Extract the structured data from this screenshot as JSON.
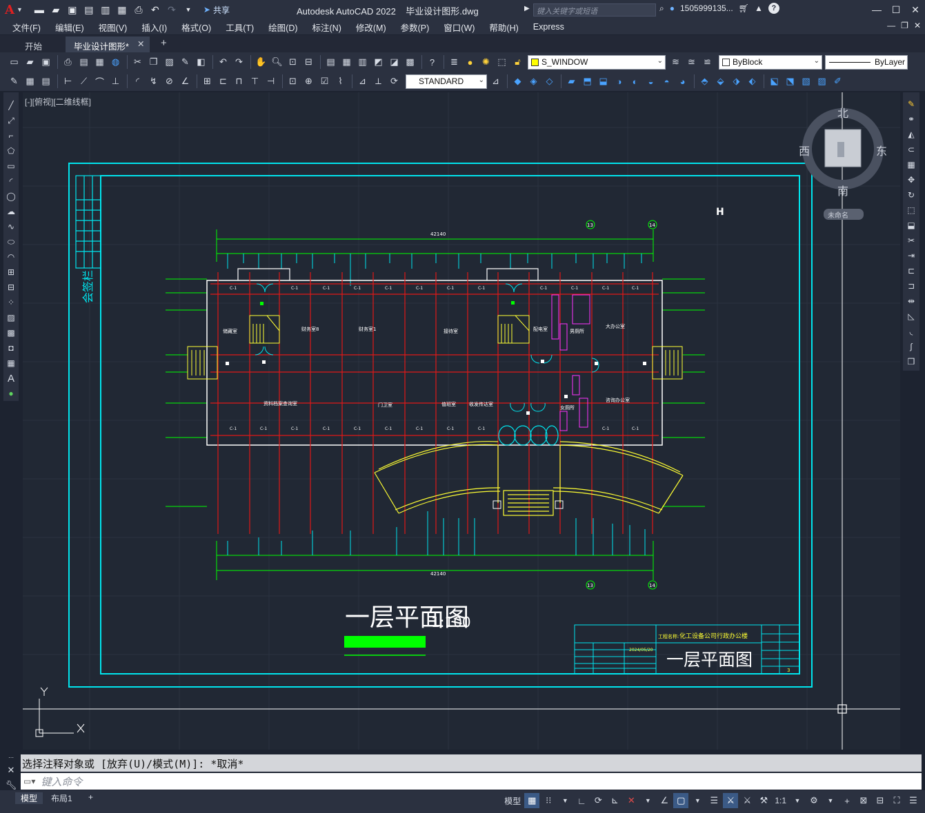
{
  "app": {
    "logo": "A",
    "title": "Autodesk AutoCAD 2022    毕业设计图形.dwg",
    "share_label": "共享",
    "search_placeholder": "键入关键字或短语",
    "user": "1505999135...",
    "window_controls": [
      "minimize-icon",
      "restore-icon",
      "close-icon"
    ]
  },
  "menu": [
    "文件(F)",
    "编辑(E)",
    "视图(V)",
    "插入(I)",
    "格式(O)",
    "工具(T)",
    "绘图(D)",
    "标注(N)",
    "修改(M)",
    "参数(P)",
    "窗口(W)",
    "帮助(H)",
    "Express"
  ],
  "tabs": {
    "start": "开始",
    "active": "毕业设计图形*",
    "add": "+"
  },
  "toolbar": {
    "layer_name": "S_WINDOW",
    "layer_color": "#ffff00",
    "color_combo": "ByBlock",
    "linetype_combo": "ByLayer",
    "textstyle_combo": "STANDARD"
  },
  "viewport": {
    "label": "[-][俯视][二维线框]",
    "viewcube": {
      "north": "北",
      "south": "南",
      "east": "东",
      "west": "西",
      "wcs": "未命名"
    }
  },
  "drawing": {
    "signature_strip": "会签栏",
    "plan_title": "一层平面图",
    "scale": "1:100",
    "overall_dim": "42140",
    "axis_left": "13",
    "axis_right": "14",
    "rooms": [
      "储藏室",
      "财务室8",
      "财务室1",
      "接待室",
      "配电室",
      "男厕所",
      "大办公室",
      "资料档案查询室",
      "门卫室",
      "值班室",
      "收发传达室",
      "女厕所",
      "咨询办公室"
    ],
    "title_block": {
      "project_label": "工程名称:",
      "project_name": "化工设备公司行政办公楼",
      "sheet_title": "一层平面图",
      "date": "2024/05/20",
      "sheet_no": "3"
    }
  },
  "command": {
    "history": "选择注释对象或 [放弃(U)/模式(M)]: *取消*",
    "placeholder": "键入命令"
  },
  "status": {
    "layout_tabs": [
      "模型",
      "布局1"
    ],
    "model_label": "模型",
    "annotation_scale": "1:1"
  },
  "colors": {
    "background": "#212834",
    "frame": "#00e5ee",
    "grid_axis": "#e01818",
    "dimension": "#00ff00",
    "stair": "#ffff33",
    "fixture": "#ff33ff",
    "wall": "#ffffff"
  }
}
